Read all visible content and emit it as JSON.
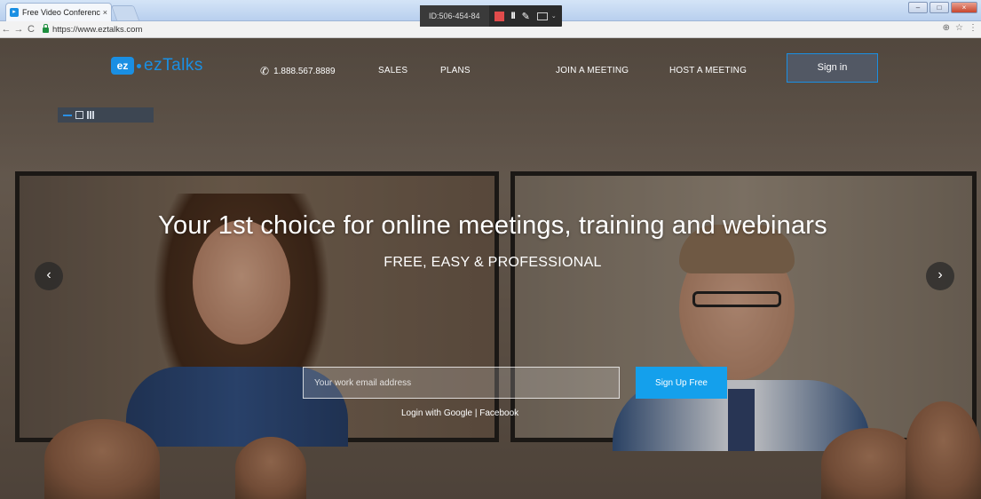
{
  "browser": {
    "tab_title": "Free Video Conferenc",
    "tab_close": "×",
    "url": "https://www.eztalks.com",
    "win_min": "–",
    "win_max": "□",
    "win_close": "×",
    "back": "←",
    "forward": "→",
    "reload": "C",
    "zoom": "⊕",
    "star": "☆",
    "menu": "⋮"
  },
  "share_toolbar": {
    "meeting_id": "ID:506-454-84",
    "pause": "II",
    "pen": "✎",
    "caret": "⌄"
  },
  "site": {
    "logo_badge": "ez",
    "logo_text": "ezTalks",
    "phone": "1.888.567.8889",
    "nav": [
      "SALES",
      "PLANS",
      "JOIN A MEETING",
      "HOST A MEETING"
    ],
    "signin_label": "Sign in"
  },
  "hero": {
    "headline": "Your 1st choice for online meetings, training and webinars",
    "subheadline": "FREE, EASY & PROFESSIONAL",
    "email_placeholder": "Your work email address",
    "signup_label": "Sign Up Free",
    "login_prefix": "Login with ",
    "login_google": "Google",
    "login_sep": " | ",
    "login_facebook": "Facebook",
    "prev_arrow": "‹",
    "next_arrow": "›"
  },
  "colors": {
    "accent": "#1a8fe3",
    "signup_button": "#14a0ec"
  }
}
